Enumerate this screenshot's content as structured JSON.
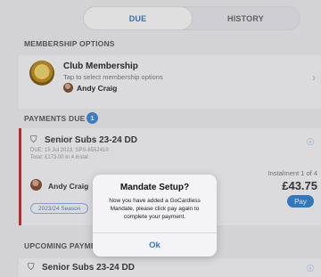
{
  "tabs": [
    {
      "label": "DUE",
      "active": true
    },
    {
      "label": "HISTORY",
      "active": false
    }
  ],
  "membership_options": {
    "heading": "MEMBERSHIP OPTIONS",
    "title": "Club Membership",
    "subtitle": "Tap to select membership options",
    "member_name": "Andy Craig"
  },
  "payments_due": {
    "heading": "PAYMENTS DUE",
    "count": "1",
    "item": {
      "title": "Senior Subs 23-24 DD",
      "due": "DUE: 15 Jul 2023, SPS-8552410",
      "total": "Total: £173.00 in 4 instal",
      "instalment": "Instalment 1 of 4",
      "amount": "£43.75",
      "pay_label": "Pay",
      "member_name": "Andy Craig",
      "season": "2023/24 Season"
    }
  },
  "upcoming": {
    "heading": "UPCOMING PAYME",
    "item_title": "Senior Subs 23-24 DD"
  },
  "dialog": {
    "title": "Mandate Setup?",
    "message": "Now you have added a GoCardless Mandate, please click pay again to complete your payment.",
    "ok_label": "Ok"
  },
  "colors": {
    "accent": "#2f78c4",
    "pay_button": "#2d83d4",
    "due_bar": "#d0242a"
  }
}
